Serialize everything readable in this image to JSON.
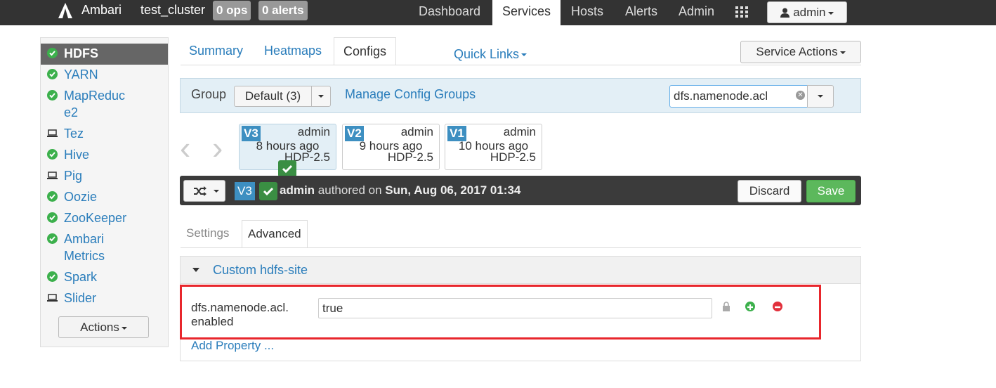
{
  "navbar": {
    "brand": "Ambari",
    "cluster": "test_cluster",
    "ops_badge": "0 ops",
    "alerts_badge": "0 alerts",
    "links": [
      "Dashboard",
      "Services",
      "Hosts",
      "Alerts",
      "Admin"
    ],
    "active_link": "Services",
    "user": "admin"
  },
  "sidebar": {
    "items": [
      {
        "label": "HDFS",
        "status": "check-icon",
        "active": true
      },
      {
        "label": "YARN",
        "status": "check-icon"
      },
      {
        "label": "MapReduc",
        "label2": "e2",
        "status": "check-icon"
      },
      {
        "label": "Tez",
        "status": "laptop-icon"
      },
      {
        "label": "Hive",
        "status": "check-icon"
      },
      {
        "label": "Pig",
        "status": "laptop-icon"
      },
      {
        "label": "Oozie",
        "status": "check-icon"
      },
      {
        "label": "ZooKeeper",
        "status": "check-icon"
      },
      {
        "label": "Ambari",
        "label2": "Metrics",
        "status": "check-icon"
      },
      {
        "label": "Spark",
        "status": "check-icon"
      },
      {
        "label": "Slider",
        "status": "laptop-icon"
      }
    ],
    "actions_label": "Actions"
  },
  "tabs": {
    "items": [
      "Summary",
      "Heatmaps",
      "Configs"
    ],
    "active": "Configs",
    "quick_links": "Quick Links",
    "service_actions": "Service Actions"
  },
  "group_bar": {
    "label": "Group",
    "selected": "Default (3)",
    "manage_link": "Manage Config Groups",
    "filter_value": "dfs.namenode.acl"
  },
  "versions": [
    {
      "label": "V3",
      "author": "admin",
      "time": "8 hours ago",
      "stack": "HDP-2.5",
      "current": true
    },
    {
      "label": "V2",
      "author": "admin",
      "time": "9 hours ago",
      "stack": "HDP-2.5"
    },
    {
      "label": "V1",
      "author": "admin",
      "time": "10 hours ago",
      "stack": "HDP-2.5"
    }
  ],
  "version_bar": {
    "version": "V3",
    "author": "admin",
    "authored_text": "authored on",
    "date": "Sun, Aug 06, 2017 01:34",
    "discard": "Discard",
    "save": "Save"
  },
  "subtabs": {
    "items": [
      "Settings",
      "Advanced"
    ],
    "active": "Advanced"
  },
  "section": {
    "title": "Custom hdfs-site",
    "property": {
      "name_line1": "dfs.namenode.acl.",
      "name_line2": "enabled",
      "value": "true"
    },
    "add_property": "Add Property ..."
  },
  "colors": {
    "accent": "#2a7dbb",
    "success": "#5cb85c",
    "danger": "#e2303c",
    "highlight": "#e8262c"
  }
}
